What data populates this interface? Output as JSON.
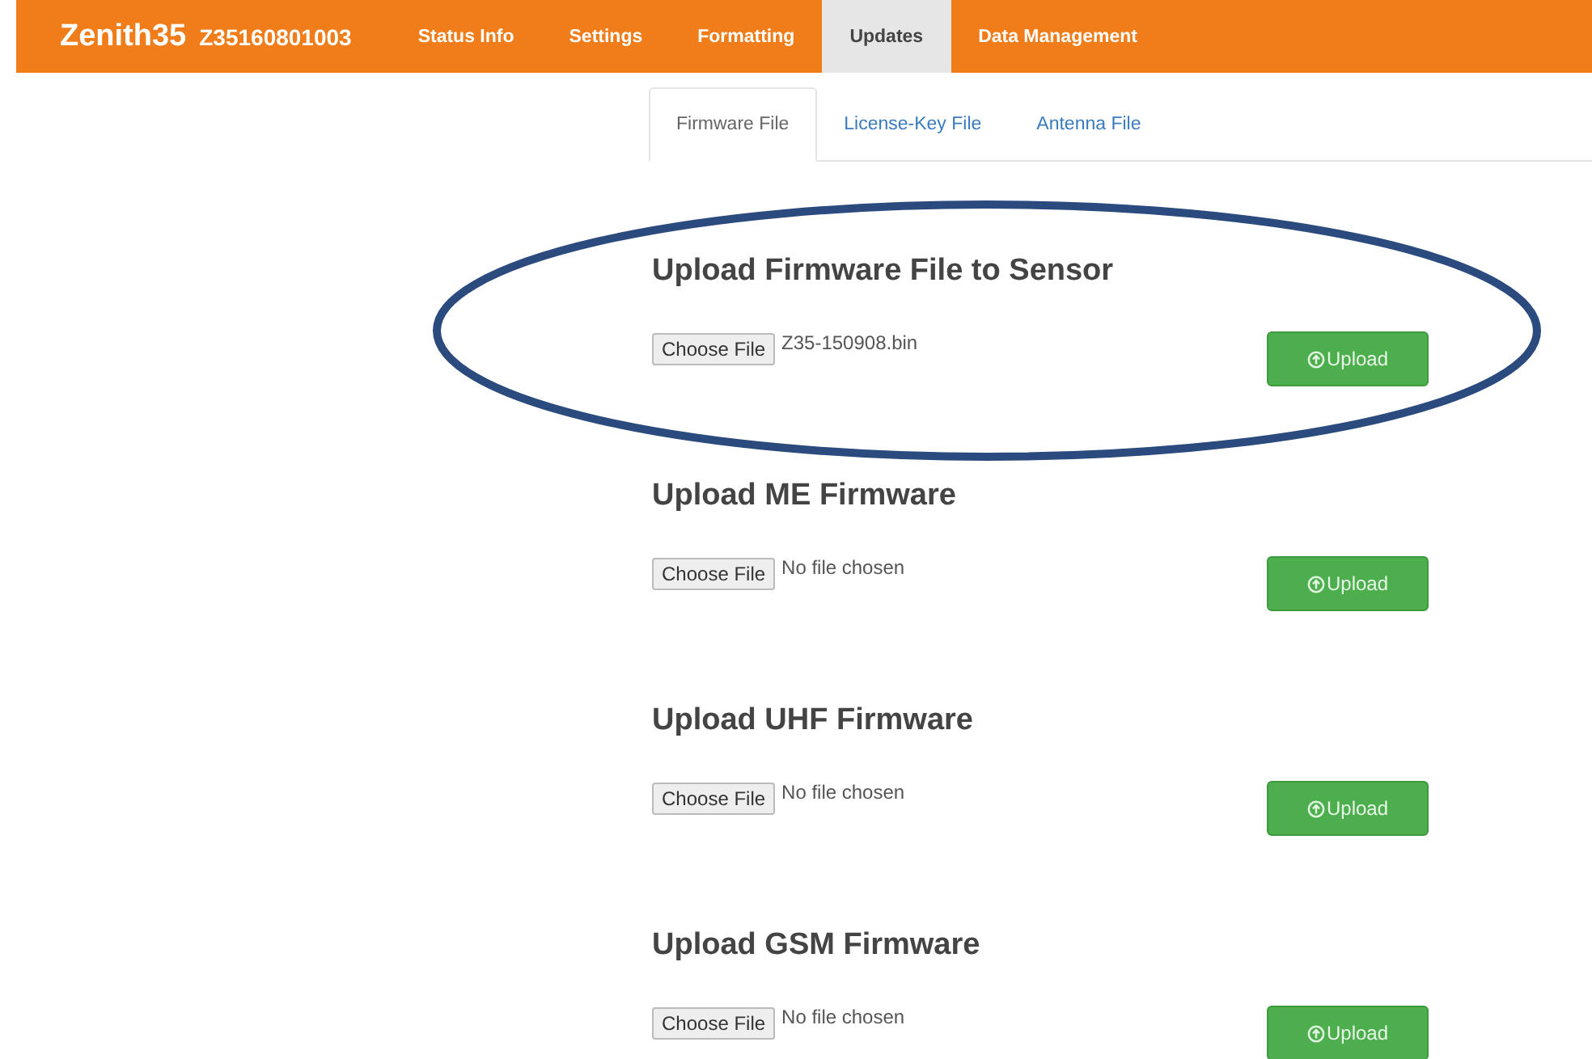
{
  "navbar": {
    "brand": "Zenith35",
    "serial": "Z35160801003",
    "items": [
      {
        "label": "Status Info",
        "selected": false
      },
      {
        "label": "Settings",
        "selected": false
      },
      {
        "label": "Formatting",
        "selected": false
      },
      {
        "label": "Updates",
        "selected": true
      },
      {
        "label": "Data Management",
        "selected": false
      }
    ]
  },
  "subtabs": [
    {
      "label": "Firmware File",
      "selected": true
    },
    {
      "label": "License-Key File",
      "selected": false
    },
    {
      "label": "Antenna File",
      "selected": false
    }
  ],
  "sections": [
    {
      "heading": "Upload Firmware File to Sensor",
      "choose_label": "Choose File",
      "file": "Z35-150908.bin",
      "upload_label": "Upload",
      "highlighted": true
    },
    {
      "heading": "Upload ME Firmware",
      "choose_label": "Choose File",
      "file": "No file chosen",
      "upload_label": "Upload",
      "highlighted": false
    },
    {
      "heading": "Upload UHF Firmware",
      "choose_label": "Choose File",
      "file": "No file chosen",
      "upload_label": "Upload",
      "highlighted": false
    },
    {
      "heading": "Upload GSM Firmware",
      "choose_label": "Choose File",
      "file": "No file chosen",
      "upload_label": "Upload",
      "highlighted": false
    }
  ]
}
